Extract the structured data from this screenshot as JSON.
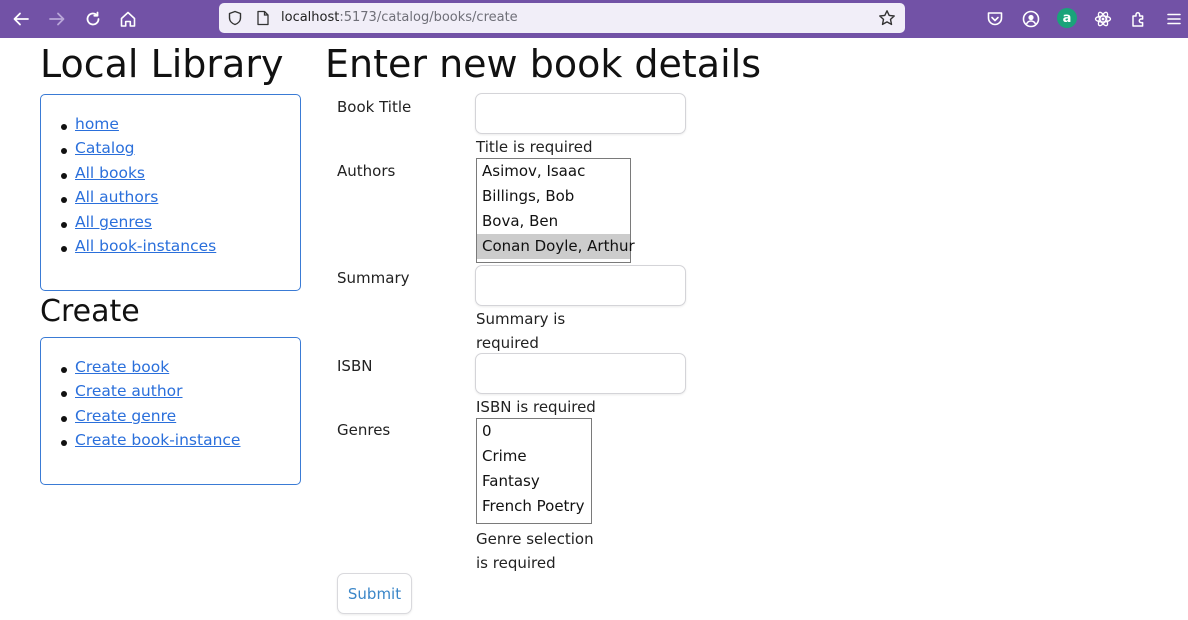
{
  "browser": {
    "url_host": "localhost",
    "url_rest": ":5173/catalog/books/create",
    "extension_badge": "a",
    "toolbar_color": "#7252a6"
  },
  "sidebar": {
    "title": "Local Library",
    "nav_items": [
      {
        "label": "home"
      },
      {
        "label": "Catalog"
      },
      {
        "label": "All books"
      },
      {
        "label": "All authors"
      },
      {
        "label": "All genres"
      },
      {
        "label": "All book-instances"
      }
    ],
    "create_title": "Create",
    "create_items": [
      {
        "label": "Create book"
      },
      {
        "label": "Create author"
      },
      {
        "label": "Create genre"
      },
      {
        "label": "Create book-instance"
      }
    ],
    "link_color": "#2a6fdb",
    "border_color": "#3a7bd5"
  },
  "form": {
    "heading": "Enter new book details",
    "title_label": "Book Title",
    "title_value": "",
    "title_error": "Title is required",
    "authors_label": "Authors",
    "authors_options": [
      "Asimov, Isaac",
      "Billings, Bob",
      "Bova, Ben",
      "Conan Doyle, Arthur"
    ],
    "authors_selected": "Conan Doyle, Arthur",
    "summary_label": "Summary",
    "summary_value": "",
    "summary_error_line1": "Summary is",
    "summary_error_line2": "required",
    "isbn_label": "ISBN",
    "isbn_value": "",
    "isbn_error": "ISBN is required",
    "genres_label": "Genres",
    "genres_options": [
      "0",
      "Crime",
      "Fantasy",
      "French Poetry"
    ],
    "genres_error_line1": "Genre selection",
    "genres_error_line2": "is required",
    "submit_label": "Submit"
  }
}
